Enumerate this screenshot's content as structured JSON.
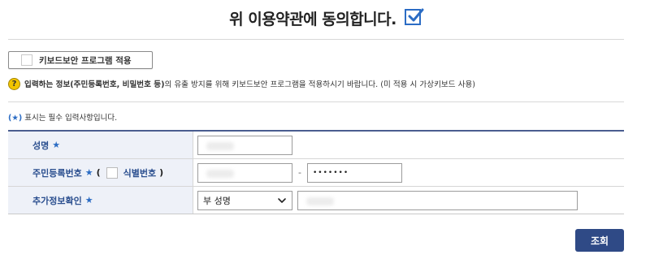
{
  "agreement": {
    "text": "위 이용약관에 동의합니다.",
    "checked": true
  },
  "keyboard_security": {
    "label": "키보드보안 프로그램 적용",
    "checked": false
  },
  "notice": {
    "icon": "question-icon",
    "part1": "입력하는 정보(주민등록번호, 비밀번호 등)",
    "part2": "의 유출 방지를 위해 키보드보안 프로그램을 적용하시기 바랍니다. (미 적용 시 가상키보드 사용)"
  },
  "required_note": {
    "mark": "(★)",
    "text": " 표시는 필수 입력사항입니다."
  },
  "form": {
    "name": {
      "label": "성명",
      "star": "★"
    },
    "rrn": {
      "label": "주민등록번호",
      "star": "★",
      "open": "(",
      "id_label": "식별번호",
      "close": ")",
      "dash": "-",
      "masked": "•••••••"
    },
    "extra": {
      "label": "추가정보확인",
      "star": "★",
      "select_value": "부 성명"
    }
  },
  "search_button": "조회",
  "colors": {
    "accent": "#2b6cc4",
    "header_border": "#4a5d8f",
    "label_bg": "#eef1f8",
    "button_bg": "#2f4a86"
  }
}
